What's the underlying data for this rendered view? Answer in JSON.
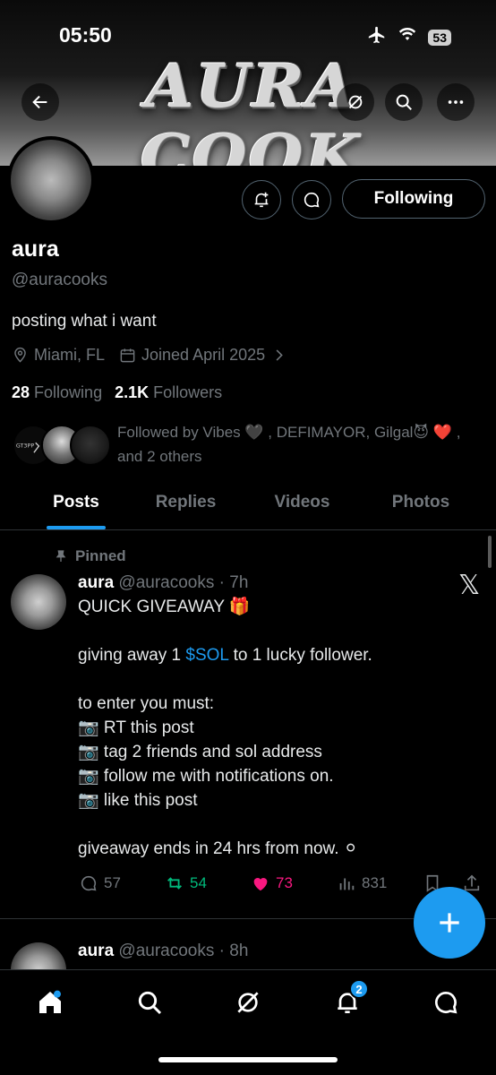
{
  "status_bar": {
    "time": "05:50",
    "battery": "53"
  },
  "banner": {
    "title": "AURA COOK"
  },
  "profile": {
    "name": "aura",
    "handle": "@auracooks",
    "bio": "posting what i want",
    "location": "Miami, FL",
    "joined": "Joined April 2025",
    "following_count": "28",
    "following_label": "Following",
    "followers_count": "2.1K",
    "followers_label": "Followers",
    "followed_by": "Followed by Vibes 🖤 , DEFIMAYOR, Gilgal😈 ❤️ , and 2 others",
    "follow_button": "Following"
  },
  "tabs": [
    {
      "label": "Posts",
      "active": true
    },
    {
      "label": "Replies",
      "active": false
    },
    {
      "label": "Videos",
      "active": false
    },
    {
      "label": "Photos",
      "active": false
    }
  ],
  "pinned_post": {
    "pinned_label": "Pinned",
    "author": "aura",
    "meta": "@auracooks · 7h",
    "lines": [
      "QUICK GIVEAWAY 🎁",
      "",
      "giving away 1 ",
      "",
      "to enter you must:",
      "📷 RT this post",
      "📷 tag 2 friends and sol address",
      "📷 follow me with notifications on.",
      "📷 like this post",
      "",
      "giveaway ends in 24 hrs from now. ⚪"
    ],
    "cashtag": "$SOL",
    "line3_rest": " to 1 lucky follower.",
    "replies": "57",
    "reposts": "54",
    "likes": "73",
    "views": "831"
  },
  "next_post": {
    "author": "aura",
    "meta": "@auracooks · 8h"
  },
  "nav": {
    "notifications_badge": "2"
  },
  "colors": {
    "accent": "#1d9bf0",
    "repost": "#00ba7c",
    "like": "#f91880",
    "muted": "#71767b"
  }
}
